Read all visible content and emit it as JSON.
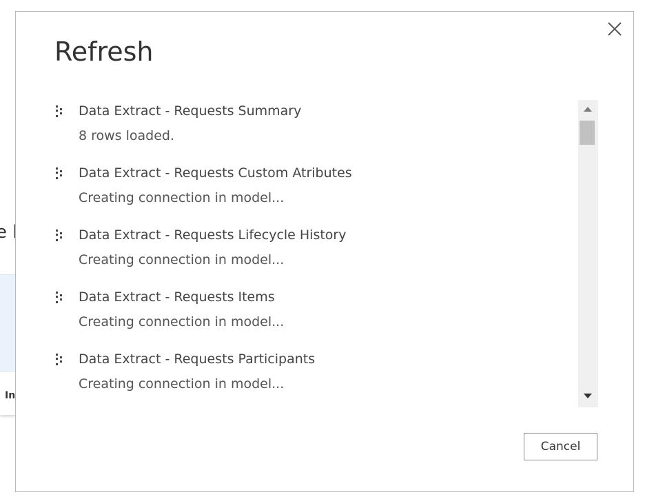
{
  "background": {
    "fragment_text": "e l",
    "label_fragment": "In"
  },
  "dialog": {
    "title": "Refresh",
    "close_icon": "close-icon",
    "items": [
      {
        "title": "Data Extract - Requests Summary",
        "status": "8 rows loaded."
      },
      {
        "title": "Data Extract - Requests Custom Atributes",
        "status": "Creating connection in model..."
      },
      {
        "title": "Data Extract - Requests Lifecycle History",
        "status": "Creating connection in model..."
      },
      {
        "title": "Data Extract - Requests Items",
        "status": "Creating connection in model..."
      },
      {
        "title": "Data Extract - Requests Participants",
        "status": "Creating connection in model..."
      }
    ],
    "cancel_label": "Cancel"
  },
  "colors": {
    "text": "#333333",
    "border": "#b9b9b9",
    "scrollbar_track": "#f0f0f0",
    "scrollbar_thumb": "#c1c1c1"
  }
}
